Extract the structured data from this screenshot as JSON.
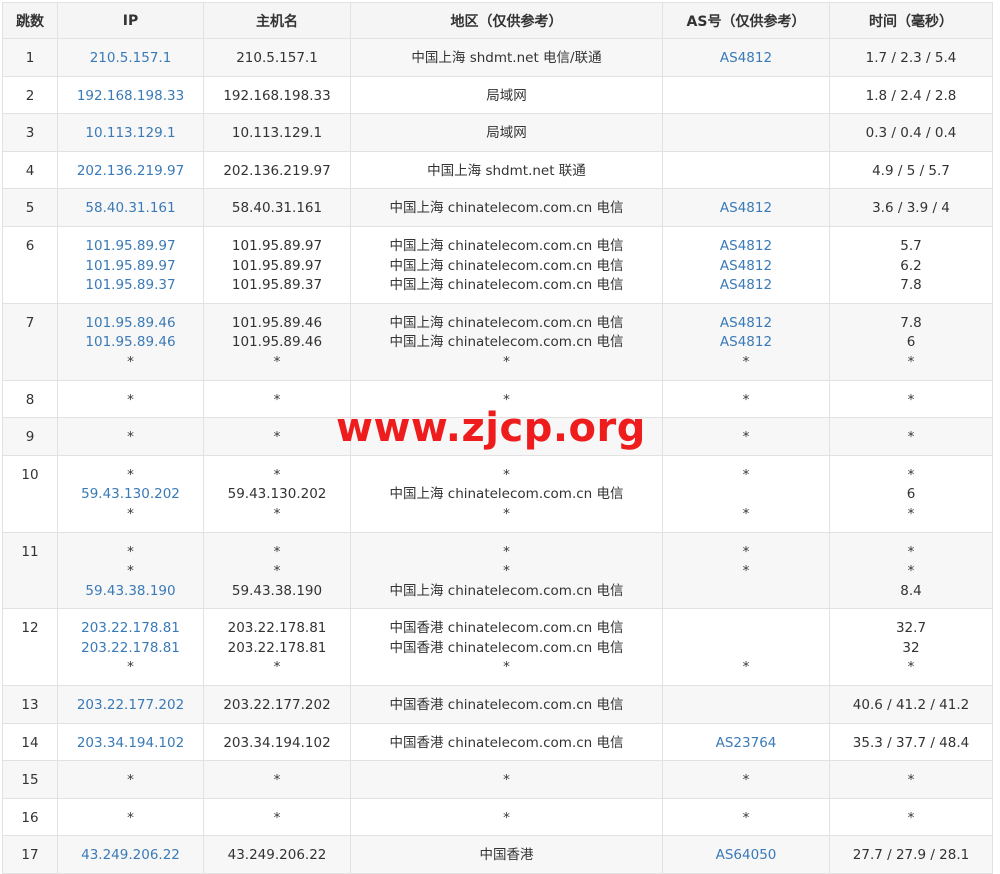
{
  "headers": [
    "跳数",
    "IP",
    "主机名",
    "地区（仅供参考）",
    "AS号（仅供参考）",
    "时间（毫秒）"
  ],
  "rows": [
    {
      "hop": "1",
      "ip": [
        "210.5.157.1"
      ],
      "host": [
        "210.5.157.1"
      ],
      "region": [
        "中国上海 shdmt.net 电信/联通"
      ],
      "as": [
        "AS4812"
      ],
      "time": [
        "1.7 / 2.3 / 5.4"
      ]
    },
    {
      "hop": "2",
      "ip": [
        "192.168.198.33"
      ],
      "host": [
        "192.168.198.33"
      ],
      "region": [
        "局域网"
      ],
      "as": [
        ""
      ],
      "time": [
        "1.8 / 2.4 / 2.8"
      ]
    },
    {
      "hop": "3",
      "ip": [
        "10.113.129.1"
      ],
      "host": [
        "10.113.129.1"
      ],
      "region": [
        "局域网"
      ],
      "as": [
        ""
      ],
      "time": [
        "0.3 / 0.4 / 0.4"
      ]
    },
    {
      "hop": "4",
      "ip": [
        "202.136.219.97"
      ],
      "host": [
        "202.136.219.97"
      ],
      "region": [
        "中国上海 shdmt.net 联通"
      ],
      "as": [
        ""
      ],
      "time": [
        "4.9 / 5 / 5.7"
      ]
    },
    {
      "hop": "5",
      "ip": [
        "58.40.31.161"
      ],
      "host": [
        "58.40.31.161"
      ],
      "region": [
        "中国上海 chinatelecom.com.cn 电信"
      ],
      "as": [
        "AS4812"
      ],
      "time": [
        "3.6 / 3.9 / 4"
      ]
    },
    {
      "hop": "6",
      "ip": [
        "101.95.89.97",
        "101.95.89.97",
        "101.95.89.37"
      ],
      "host": [
        "101.95.89.97",
        "101.95.89.97",
        "101.95.89.37"
      ],
      "region": [
        "中国上海 chinatelecom.com.cn 电信",
        "中国上海 chinatelecom.com.cn 电信",
        "中国上海 chinatelecom.com.cn 电信"
      ],
      "as": [
        "AS4812",
        "AS4812",
        "AS4812"
      ],
      "time": [
        "5.7",
        "6.2",
        "7.8"
      ]
    },
    {
      "hop": "7",
      "ip": [
        "101.95.89.46",
        "101.95.89.46",
        "*"
      ],
      "host": [
        "101.95.89.46",
        "101.95.89.46",
        "*"
      ],
      "region": [
        "中国上海 chinatelecom.com.cn 电信",
        "中国上海 chinatelecom.com.cn 电信",
        "*"
      ],
      "as": [
        "AS4812",
        "AS4812",
        "*"
      ],
      "time": [
        "7.8",
        "6",
        "*"
      ]
    },
    {
      "hop": "8",
      "ip": [
        "*"
      ],
      "host": [
        "*"
      ],
      "region": [
        "*"
      ],
      "as": [
        "*"
      ],
      "time": [
        "*"
      ]
    },
    {
      "hop": "9",
      "ip": [
        "*"
      ],
      "host": [
        "*"
      ],
      "region": [
        "*"
      ],
      "as": [
        "*"
      ],
      "time": [
        "*"
      ]
    },
    {
      "hop": "10",
      "ip": [
        "*",
        "59.43.130.202",
        "*"
      ],
      "host": [
        "*",
        "59.43.130.202",
        "*"
      ],
      "region": [
        "*",
        "中国上海 chinatelecom.com.cn 电信",
        "*"
      ],
      "as": [
        "*",
        "",
        "*"
      ],
      "time": [
        "*",
        "6",
        "*"
      ]
    },
    {
      "hop": "11",
      "ip": [
        "*",
        "*",
        "59.43.38.190"
      ],
      "host": [
        "*",
        "*",
        "59.43.38.190"
      ],
      "region": [
        "*",
        "*",
        "中国上海 chinatelecom.com.cn 电信"
      ],
      "as": [
        "*",
        "*",
        ""
      ],
      "time": [
        "*",
        "*",
        "8.4"
      ]
    },
    {
      "hop": "12",
      "ip": [
        "203.22.178.81",
        "203.22.178.81",
        "*"
      ],
      "host": [
        "203.22.178.81",
        "203.22.178.81",
        "*"
      ],
      "region": [
        "中国香港 chinatelecom.com.cn 电信",
        "中国香港 chinatelecom.com.cn 电信",
        "*"
      ],
      "as": [
        "",
        "",
        "*"
      ],
      "time": [
        "32.7",
        "32",
        "*"
      ]
    },
    {
      "hop": "13",
      "ip": [
        "203.22.177.202"
      ],
      "host": [
        "203.22.177.202"
      ],
      "region": [
        "中国香港 chinatelecom.com.cn 电信"
      ],
      "as": [
        ""
      ],
      "time": [
        "40.6 / 41.2 / 41.2"
      ]
    },
    {
      "hop": "14",
      "ip": [
        "203.34.194.102"
      ],
      "host": [
        "203.34.194.102"
      ],
      "region": [
        "中国香港 chinatelecom.com.cn 电信"
      ],
      "as": [
        "AS23764"
      ],
      "time": [
        "35.3 / 37.7 / 48.4"
      ]
    },
    {
      "hop": "15",
      "ip": [
        "*"
      ],
      "host": [
        "*"
      ],
      "region": [
        "*"
      ],
      "as": [
        "*"
      ],
      "time": [
        "*"
      ]
    },
    {
      "hop": "16",
      "ip": [
        "*"
      ],
      "host": [
        "*"
      ],
      "region": [
        "*"
      ],
      "as": [
        "*"
      ],
      "time": [
        "*"
      ]
    },
    {
      "hop": "17",
      "ip": [
        "43.249.206.22"
      ],
      "host": [
        "43.249.206.22"
      ],
      "region": [
        "中国香港"
      ],
      "as": [
        "AS64050"
      ],
      "time": [
        "27.7 / 27.9 / 28.1"
      ]
    }
  ],
  "watermark": "www.zjcp.org",
  "colors": {
    "link": "#3a7ab7",
    "watermark": "#ee1c1c",
    "header_bg": "#f5f5f5",
    "stripe_bg": "#f7f7f7",
    "border": "#e2e2e2"
  }
}
